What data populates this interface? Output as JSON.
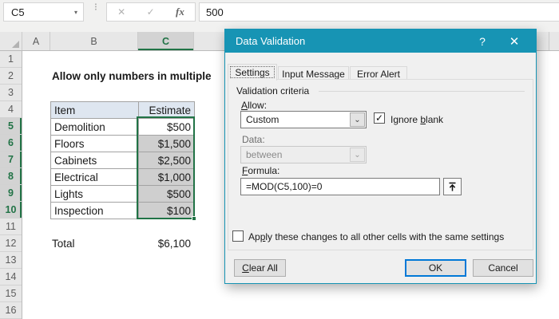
{
  "colors": {
    "titlebar_teal": "#1794B4",
    "excel_green": "#217346",
    "selected_cell_fill": "#CFCFCF",
    "table_header_fill": "#DEE6F0",
    "ok_button_border": "#0078D7"
  },
  "icons": {
    "name_box_dropdown": "▾",
    "cancel_entry": "✕",
    "confirm_entry": "✓",
    "fx": "fx",
    "help": "?",
    "close": "✕",
    "chevron_down": "⌄",
    "checkmark": "✓"
  },
  "formula_bar": {
    "name_box_value": "C5",
    "cell_value": "500"
  },
  "sheet": {
    "col_headers": [
      "A",
      "B",
      "C"
    ],
    "row_headers": [
      "1",
      "2",
      "3",
      "4",
      "5",
      "6",
      "7",
      "8",
      "9",
      "10",
      "11",
      "12",
      "13",
      "14",
      "15",
      "16"
    ],
    "title": "Allow only numbers in multiple",
    "table": {
      "header": [
        "Item",
        "Estimate"
      ],
      "rows": [
        [
          "Demolition",
          "$500"
        ],
        [
          "Floors",
          "$1,500"
        ],
        [
          "Cabinets",
          "$2,500"
        ],
        [
          "Electrical",
          "$1,000"
        ],
        [
          "Lights",
          "$500"
        ],
        [
          "Inspection",
          "$100"
        ]
      ]
    },
    "total_label": "Total",
    "total_value": "$6,100"
  },
  "dialog": {
    "title": "Data Validation",
    "tabs": [
      "Settings",
      "Input Message",
      "Error Alert"
    ],
    "group_label": "Validation criteria",
    "allow_label": {
      "u": "A",
      "rest": "llow:"
    },
    "allow_value": "Custom",
    "ignore_blank": {
      "pre": "Ignore ",
      "u": "b",
      "rest": "lank"
    },
    "data_label": "Data:",
    "data_value": "between",
    "formula_label": {
      "u": "F",
      "rest": "ormula:"
    },
    "formula_value": "=MOD(C5,100)=0",
    "apply_label": {
      "pre": "Ap",
      "u": "p",
      "rest": "ly these changes to all other cells with the same settings"
    },
    "buttons": {
      "clear": {
        "u": "C",
        "rest": "lear All"
      },
      "ok": "OK",
      "cancel": "Cancel"
    }
  }
}
